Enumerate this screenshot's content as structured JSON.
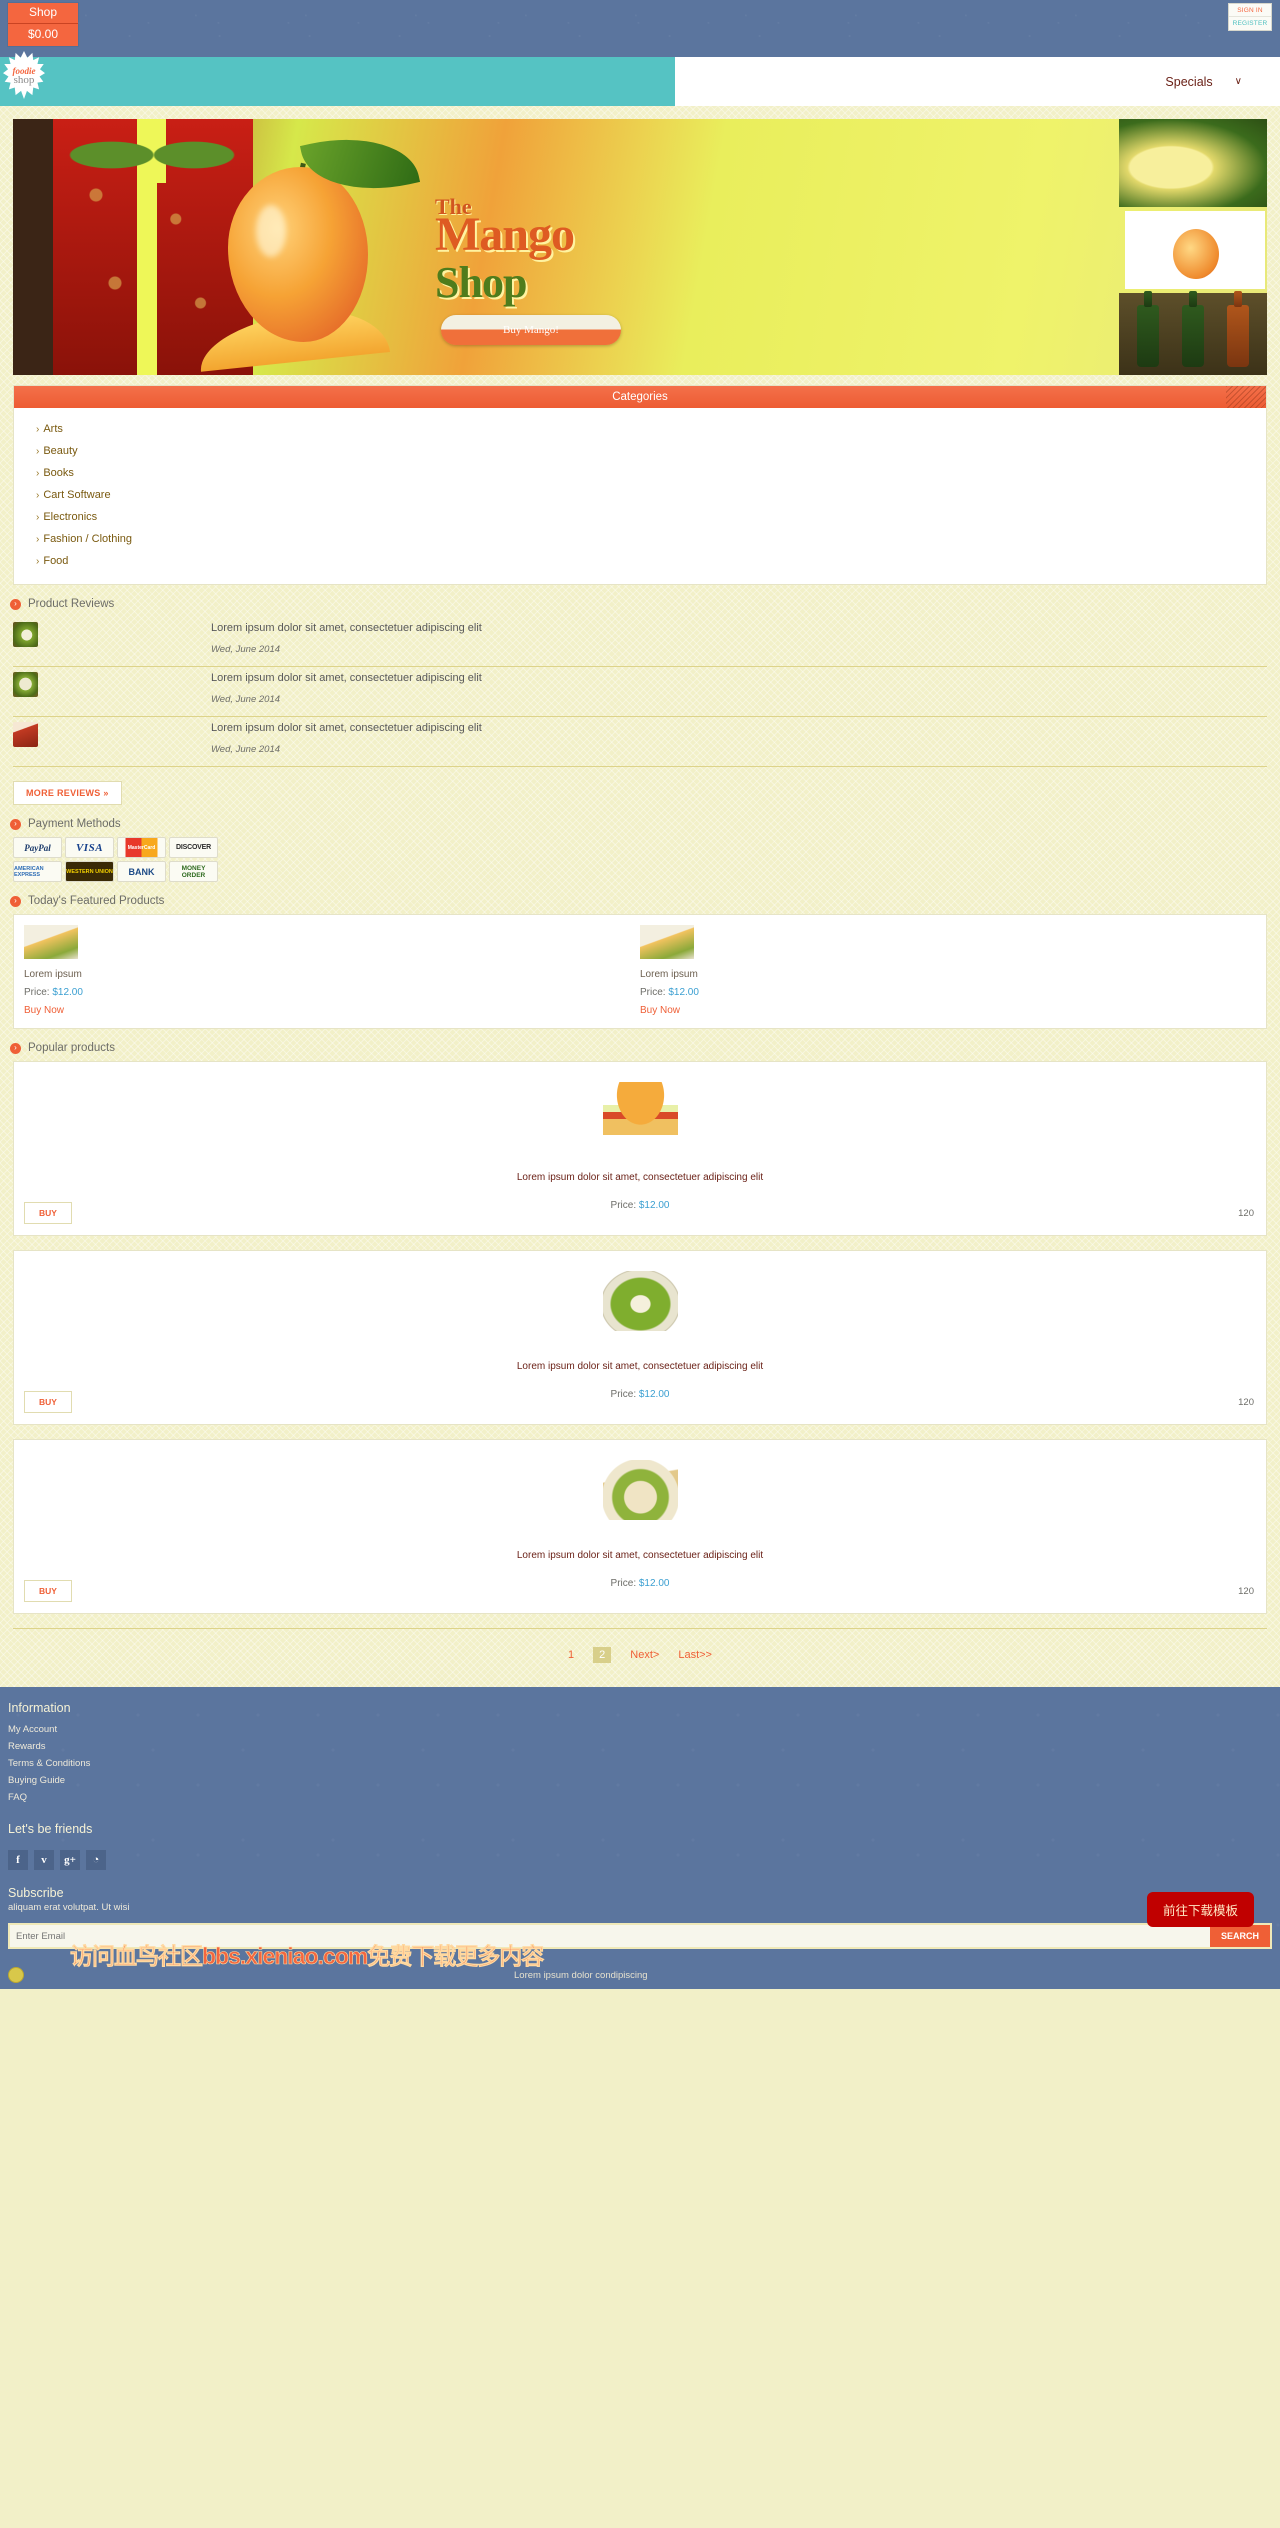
{
  "topbar": {
    "cart_label": "Shop",
    "cart_total": "$0.00",
    "sign_in": "SIGN IN",
    "register": "REGISTER"
  },
  "nav": {
    "logo_line1": "foodie",
    "logo_line2": "shop",
    "menu_label": "Specials",
    "chevron": "∨"
  },
  "banner": {
    "title_small": "The",
    "title_big": "Mango",
    "title_green": "Shop",
    "pill_label": "Buy Mango!"
  },
  "categories": {
    "heading": "Categories",
    "arrow": "›",
    "items": [
      {
        "label": "Arts"
      },
      {
        "label": "Beauty"
      },
      {
        "label": "Books"
      },
      {
        "label": "Cart Software"
      },
      {
        "label": "Electronics"
      },
      {
        "label": "Fashion / Clothing"
      },
      {
        "label": "Food"
      }
    ]
  },
  "reviews": {
    "heading": "Product Reviews",
    "bullet": "›",
    "items": [
      {
        "title": "Lorem ipsum dolor sit amet, consectetuer adipiscing elit",
        "date": "Wed, June 2014"
      },
      {
        "title": "Lorem ipsum dolor sit amet, consectetuer adipiscing elit",
        "date": "Wed, June 2014"
      },
      {
        "title": "Lorem ipsum dolor sit amet, consectetuer adipiscing elit",
        "date": "Wed, June 2014"
      }
    ],
    "more_label": "MORE REVIEWS »"
  },
  "payment": {
    "heading": "Payment Methods",
    "methods": [
      {
        "label": "PayPal"
      },
      {
        "label": "VISA"
      },
      {
        "label": "MasterCard"
      },
      {
        "label": "DISCOVER"
      },
      {
        "label": "AMERICAN EXPRESS"
      },
      {
        "label": "WESTERN UNION"
      },
      {
        "label": "BANK"
      },
      {
        "label": "MONEY ORDER"
      }
    ]
  },
  "featured": {
    "heading": "Today's Featured Products",
    "items": [
      {
        "name": "Lorem ipsum",
        "price_label": "Price:",
        "price": "$12.00",
        "buy_label": "Buy Now"
      },
      {
        "name": "Lorem ipsum",
        "price_label": "Price:",
        "price": "$12.00",
        "buy_label": "Buy Now"
      }
    ]
  },
  "popular": {
    "heading": "Popular products",
    "items": [
      {
        "title": "Lorem ipsum dolor sit amet, consectetuer adipiscing elit",
        "price_label": "Price:",
        "price": "$12.00",
        "buy_label": "BUY",
        "count": "120"
      },
      {
        "title": "Lorem ipsum dolor sit amet, consectetuer adipiscing elit",
        "price_label": "Price:",
        "price": "$12.00",
        "buy_label": "BUY",
        "count": "120"
      },
      {
        "title": "Lorem ipsum dolor sit amet, consectetuer adipiscing elit",
        "price_label": "Price:",
        "price": "$12.00",
        "buy_label": "BUY",
        "count": "120"
      }
    ]
  },
  "pagination": {
    "page_1": "1",
    "page_2": "2",
    "next": "Next>",
    "last": "Last>>"
  },
  "footer": {
    "info_heading": "Information",
    "links": [
      {
        "label": "My Account"
      },
      {
        "label": "Rewards"
      },
      {
        "label": "Terms & Conditions"
      },
      {
        "label": "Buying Guide"
      },
      {
        "label": "FAQ"
      }
    ],
    "friends_heading": "Let's be friends",
    "social": [
      {
        "name": "facebook",
        "glyph": "f"
      },
      {
        "name": "twitter",
        "glyph": "ᴠ"
      },
      {
        "name": "google-plus",
        "glyph": "g+"
      },
      {
        "name": "rss",
        "glyph": "◔"
      }
    ],
    "subscribe_heading": "Subscribe",
    "subscribe_text": "aliquam erat volutpat. Ut wisi",
    "email_placeholder": "Enter Email",
    "search_label": "SEARCH",
    "bottom_text": "Lorem ipsum dolor condipiscing",
    "download_button": "前往下载模板",
    "watermark": "访问血鸟社区bbs.xieniao.com免费下载更多内容"
  }
}
